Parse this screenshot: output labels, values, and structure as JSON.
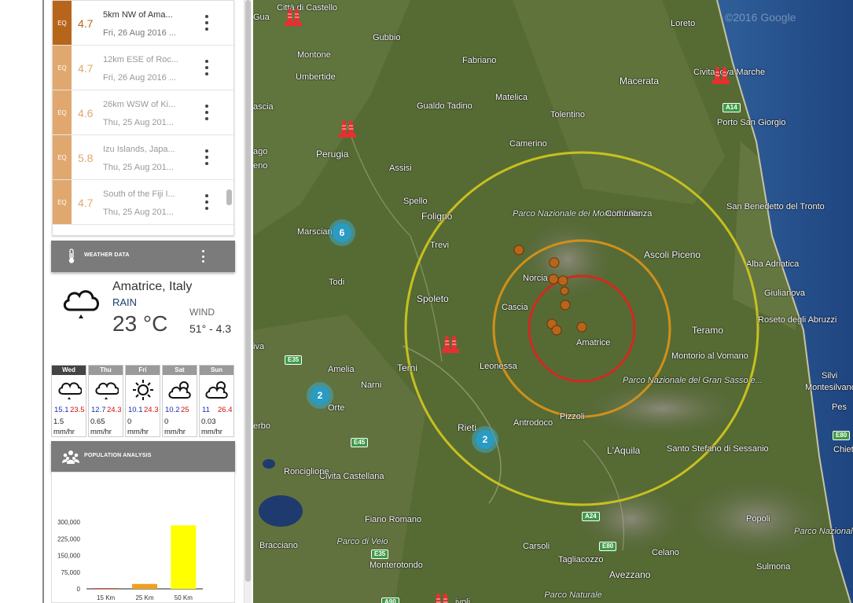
{
  "earthquakes": [
    {
      "badge": "EQ",
      "mag": "4.7",
      "place": "5km NW of Ama...",
      "date": "Fri, 26 Aug 2016 ...",
      "badge_color": "#b8651c",
      "mag_color": "#b8651c",
      "faded": false
    },
    {
      "badge": "EQ",
      "mag": "4.7",
      "place": "12km ESE of Roc...",
      "date": "Fri, 26 Aug 2016 ...",
      "badge_color": "#e0a86e",
      "mag_color": "#e0a86e",
      "faded": true
    },
    {
      "badge": "EQ",
      "mag": "4.6",
      "place": "26km WSW of Ki...",
      "date": "Thu, 25 Aug 201...",
      "badge_color": "#e0a86e",
      "mag_color": "#e0a86e",
      "faded": true
    },
    {
      "badge": "EQ",
      "mag": "5.8",
      "place": "Izu Islands, Japa...",
      "date": "Thu, 25 Aug 201...",
      "badge_color": "#e0a86e",
      "mag_color": "#e0a86e",
      "faded": true
    },
    {
      "badge": "EQ",
      "mag": "4.7",
      "place": "South of the Fiji I...",
      "date": "Thu, 25 Aug 201...",
      "badge_color": "#e0a86e",
      "mag_color": "#e0a86e",
      "faded": true
    }
  ],
  "weather": {
    "header": "WEATHER DATA",
    "city": "Amatrice, Italy",
    "condition": "RAIN",
    "temperature": "23 °C",
    "wind_label": "WIND",
    "wind_value": "51° - 4.3",
    "days": [
      {
        "name": "Wed",
        "icon": "rain-cloud-icon",
        "lo": "15.1",
        "hi": "23.5",
        "rain": "1.5",
        "unit": "mm/hr",
        "active": true
      },
      {
        "name": "Thu",
        "icon": "rain-cloud-icon",
        "lo": "12.7",
        "hi": "24.3",
        "rain": "0.65",
        "unit": "mm/hr",
        "active": false
      },
      {
        "name": "Fri",
        "icon": "sun-icon",
        "lo": "10.1",
        "hi": "24.3",
        "rain": "0",
        "unit": "mm/hr",
        "active": false
      },
      {
        "name": "Sat",
        "icon": "partly-cloudy-icon",
        "lo": "10.2",
        "hi": "25",
        "rain": "0",
        "unit": "mm/hr",
        "active": false
      },
      {
        "name": "Sun",
        "icon": "partly-cloudy-icon",
        "lo": "11",
        "hi": "26.4",
        "rain": "0.03",
        "unit": "mm/hr",
        "active": false
      }
    ]
  },
  "population": {
    "header": "POPULATION ANALYSIS"
  },
  "chart_data": {
    "type": "bar",
    "categories": [
      "15 Km",
      "25 Km",
      "50 Km"
    ],
    "values": [
      3000,
      22000,
      285000
    ],
    "colors": [
      "#c0392b",
      "#f0a020",
      "#ffff00"
    ],
    "yticks": [
      "300,000",
      "225,000",
      "150,000",
      "75,000",
      "0"
    ],
    "ytick_values": [
      300000,
      225000,
      150000,
      75000,
      0
    ],
    "ylim": [
      0,
      300000
    ],
    "title": "",
    "xlabel": "",
    "ylabel": ""
  },
  "map": {
    "watermark": "©2016 Google",
    "labels": [
      {
        "text": "Città di Castello",
        "kind": "town"
      },
      {
        "text": "Montone",
        "kind": "town"
      },
      {
        "text": "Gubbio",
        "kind": "town"
      },
      {
        "text": "Fabriano",
        "kind": "town"
      },
      {
        "text": "Umbertide",
        "kind": "town"
      },
      {
        "text": "Macerata",
        "kind": "big"
      },
      {
        "text": "Loreto",
        "kind": "town"
      },
      {
        "text": "Civitanova Marche",
        "kind": "town"
      },
      {
        "text": "Gualdo Tadino",
        "kind": "town"
      },
      {
        "text": "Matelica",
        "kind": "town"
      },
      {
        "text": "Tolentino",
        "kind": "town"
      },
      {
        "text": "Porto San Giorgio",
        "kind": "town"
      },
      {
        "text": "Perugia",
        "kind": "big"
      },
      {
        "text": "Camerino",
        "kind": "town"
      },
      {
        "text": "Assisi",
        "kind": "town"
      },
      {
        "text": "Spello",
        "kind": "town"
      },
      {
        "text": "Foligno",
        "kind": "big"
      },
      {
        "text": "Parco Nazionale dei Monti Sibillini",
        "kind": "park"
      },
      {
        "text": "Comunanza",
        "kind": "town"
      },
      {
        "text": "San Benedetto del Tronto",
        "kind": "town"
      },
      {
        "text": "Marsciano",
        "kind": "town"
      },
      {
        "text": "Trevi",
        "kind": "town"
      },
      {
        "text": "Ascoli Piceno",
        "kind": "big"
      },
      {
        "text": "Alba Adriatica",
        "kind": "town"
      },
      {
        "text": "Norcia",
        "kind": "town"
      },
      {
        "text": "Todi",
        "kind": "town"
      },
      {
        "text": "Spoleto",
        "kind": "big"
      },
      {
        "text": "Cascia",
        "kind": "town"
      },
      {
        "text": "Giulianova",
        "kind": "town"
      },
      {
        "text": "Roseto degli Abruzzi",
        "kind": "town"
      },
      {
        "text": "Teramo",
        "kind": "big"
      },
      {
        "text": "Amatrice",
        "kind": "town"
      },
      {
        "text": "Montorio al Vomano",
        "kind": "town"
      },
      {
        "text": "Amelia",
        "kind": "town"
      },
      {
        "text": "Terni",
        "kind": "big"
      },
      {
        "text": "Leonessa",
        "kind": "town"
      },
      {
        "text": "Narni",
        "kind": "town"
      },
      {
        "text": "Parco Nazionale del Gran Sasso e...",
        "kind": "park"
      },
      {
        "text": "Silvi",
        "kind": "town"
      },
      {
        "text": "Montesilvano",
        "kind": "town"
      },
      {
        "text": "Orte",
        "kind": "town"
      },
      {
        "text": "Pizzoli",
        "kind": "town"
      },
      {
        "text": "Rieti",
        "kind": "big"
      },
      {
        "text": "Antrodoco",
        "kind": "town"
      },
      {
        "text": "L'Aquila",
        "kind": "big"
      },
      {
        "text": "Santo Stefano di Sessanio",
        "kind": "town"
      },
      {
        "text": "Chieti",
        "kind": "town"
      },
      {
        "text": "Civita Castellana",
        "kind": "town"
      },
      {
        "text": "Ronciglione",
        "kind": "town"
      },
      {
        "text": "Fiano Romano",
        "kind": "town"
      },
      {
        "text": "Popoli",
        "kind": "town"
      },
      {
        "text": "Bracciano",
        "kind": "town"
      },
      {
        "text": "Parco di Veio",
        "kind": "park"
      },
      {
        "text": "Carsoli",
        "kind": "town"
      },
      {
        "text": "Celano",
        "kind": "town"
      },
      {
        "text": "Parco Nazionale della Majella",
        "kind": "park"
      },
      {
        "text": "Monterotondo",
        "kind": "town"
      },
      {
        "text": "Tagliacozzo",
        "kind": "town"
      },
      {
        "text": "Avezzano",
        "kind": "big"
      },
      {
        "text": "Sulmona",
        "kind": "town"
      },
      {
        "text": "Parco Naturale",
        "kind": "park"
      },
      {
        "text": "ivoli",
        "kind": "town"
      },
      {
        "text": "erbo",
        "kind": "town"
      },
      {
        "text": "ascia",
        "kind": "town"
      },
      {
        "text": "eno",
        "kind": "town"
      },
      {
        "text": "ago",
        "kind": "town"
      },
      {
        "text": "iva",
        "kind": "town"
      },
      {
        "text": "Pes",
        "kind": "town"
      },
      {
        "text": "Gua",
        "kind": "town"
      }
    ],
    "roads": [
      "A14",
      "E35",
      "E45",
      "E35",
      "A24",
      "E80",
      "E80",
      "A90"
    ],
    "clusters": [
      "6",
      "2",
      "2"
    ]
  }
}
